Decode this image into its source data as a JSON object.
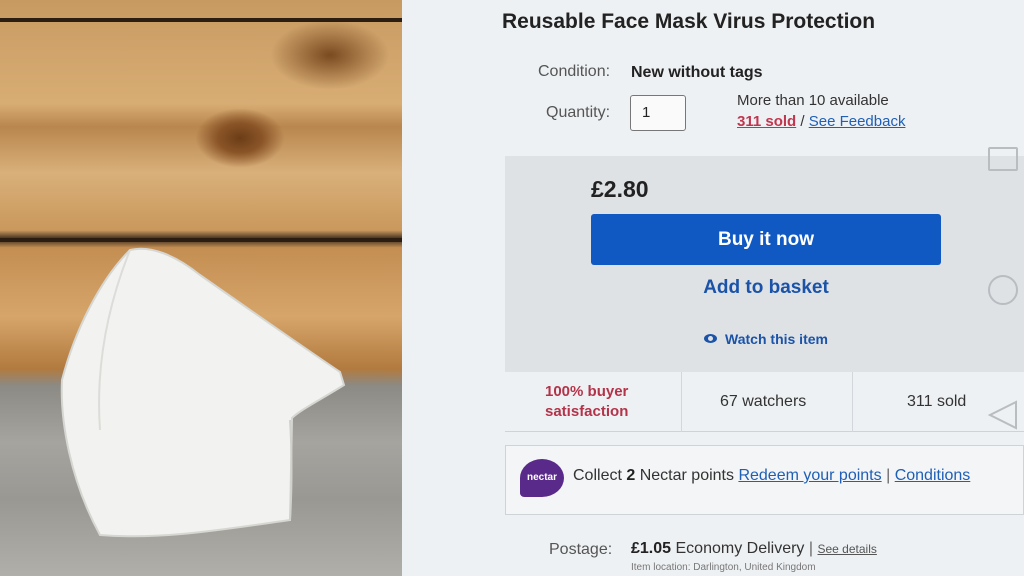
{
  "listing": {
    "title": "Reusable Face Mask Virus Protection",
    "condition_label": "Condition:",
    "condition_value": "New without tags",
    "quantity_label": "Quantity:",
    "quantity_value": "1",
    "availability": "More than 10 available",
    "sold_link": "311 sold",
    "sold_separator": "/",
    "feedback_link": "See Feedback"
  },
  "buybox": {
    "price": "£2.80",
    "buy_now": "Buy it now",
    "add_to_basket": "Add to basket",
    "watch": "Watch this item"
  },
  "stats": {
    "satisfaction_line1": "100% buyer",
    "satisfaction_line2": "satisfaction",
    "watchers": "67 watchers",
    "sold": "311 sold"
  },
  "nectar": {
    "logo_text": "nectar",
    "collect_prefix": "Collect",
    "points": "2",
    "collect_suffix": "Nectar points",
    "redeem_link": "Redeem your points",
    "separator": "|",
    "conditions_link": "Conditions"
  },
  "postage": {
    "label": "Postage:",
    "price": "£1.05",
    "method": "Economy Delivery",
    "separator": "|",
    "details_link": "See details",
    "location": "Item location:  Darlington, United Kingdom"
  },
  "colors": {
    "buy_button": "#1159c2",
    "link": "#1f5fb6",
    "sold_accent": "#c0364f",
    "nectar_brand": "#5a2a8a"
  },
  "icons": [
    "eye-icon",
    "nectar-logo",
    "square-nav-icon",
    "circle-nav-icon",
    "triangle-back-icon"
  ]
}
